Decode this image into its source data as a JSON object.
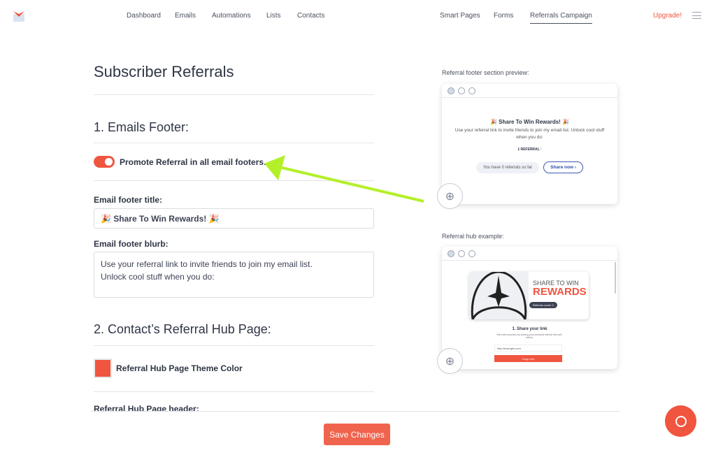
{
  "nav": {
    "left": [
      "Dashboard",
      "Emails",
      "Automations",
      "Lists",
      "Contacts"
    ],
    "right": [
      "Smart Pages",
      "Forms",
      "Referrals Campaign"
    ],
    "active": "Referrals Campaign",
    "upgrade": "Upgrade!"
  },
  "page": {
    "title": "Subscriber Referrals"
  },
  "section1": {
    "heading": "1. Emails Footer:",
    "toggle_label": "Promote Referral in all email footers.",
    "toggle_on": true,
    "title_label": "Email footer title:",
    "title_value": "🎉 Share To Win Rewards! 🎉",
    "blurb_label": "Email footer blurb:",
    "blurb_value": "Use your referral link to invite friends to join my email list.\nUnlock cool stuff when you do:"
  },
  "section2": {
    "heading": "2. Contact’s Referral Hub Page:",
    "color_label": "Referral Hub Page Theme Color",
    "theme_color": "#f0553f",
    "header_label": "Referral Hub Page header:"
  },
  "preview": {
    "caption": "Referral footer section preview:",
    "title": "🎉 Share To Win Rewards! 🎉",
    "text": "Use your referral link to invite friends to join my email list. Unlock cool stuff when you do:",
    "tier": "1 REFERRAL",
    "tier_suffix": "!",
    "count_text": "You have 0 referrals so far",
    "share": "Share now"
  },
  "hub": {
    "caption": "Referral hub example:",
    "share_to_win": "SHARE TO WIN",
    "rewards": "REWARDS",
    "count_pill": "Referral count: 0",
    "step": "1. Share your link",
    "step_text": "Win referral prizes by sharing your personal referral link with others",
    "url": "http://example.com",
    "copy": "Copy Link"
  },
  "footer": {
    "save": "Save Changes"
  },
  "colors": {
    "accent": "#f0553f",
    "arrow": "#b4f02a"
  }
}
